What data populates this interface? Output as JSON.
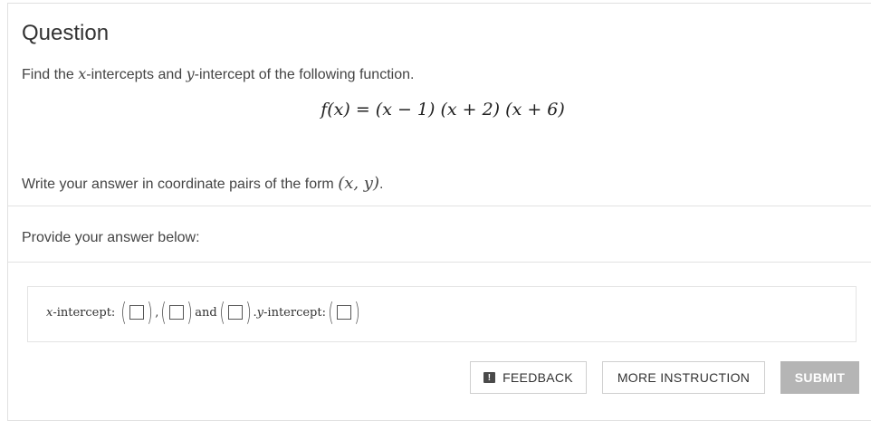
{
  "question": {
    "title": "Question",
    "prompt_prefix": "Find the ",
    "prompt_x": "x",
    "prompt_mid": "-intercepts and ",
    "prompt_y": "y",
    "prompt_suffix": "-intercept of the following function.",
    "formula": {
      "lhs": "f(x) = ",
      "factor1": "(x − 1)",
      "factor2": "(x + 2)",
      "factor3": "(x + 6)"
    },
    "instruction_prefix": "Write your answer in coordinate pairs of the form ",
    "instruction_math": "(x, y)",
    "instruction_suffix": "."
  },
  "answer": {
    "label": "Provide your answer below:",
    "x_intercept_label": "x",
    "x_intercept_suffix": " -intercept: ",
    "comma": ",",
    "and_label": " and ",
    "period": ".",
    "y_intercept_label": " y",
    "y_intercept_suffix": " -intercept:"
  },
  "buttons": {
    "feedback": "FEEDBACK",
    "more_instruction": "MORE INSTRUCTION",
    "submit": "SUBMIT"
  },
  "icons": {
    "feedback": "feedback-icon"
  }
}
